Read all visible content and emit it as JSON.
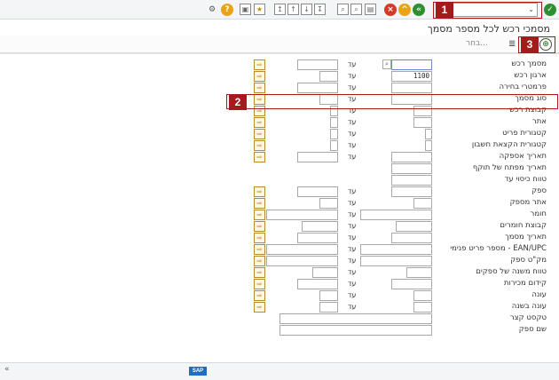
{
  "window": {
    "title": "מסמכי רכש לכל מספר מסמך"
  },
  "toolbar": {
    "command_value": "",
    "icons": [
      "check-icon",
      "back-icon",
      "exit-icon",
      "cancel-icon",
      "print-icon",
      "find-icon",
      "find-next-icon",
      "first-page-icon",
      "prev-page-icon",
      "next-page-icon",
      "last-page-icon",
      "new-session-icon",
      "shortcut-icon",
      "help-icon",
      "settings-icon"
    ]
  },
  "app_toolbar": {
    "choose_label": "בחר..."
  },
  "form": {
    "to_label": "עד",
    "rows": [
      {
        "label": "מסמך רכש",
        "from": "",
        "to": ""
      },
      {
        "label": "ארגון רכש",
        "from": "1100",
        "to": ""
      },
      {
        "label": "פרמטרי בחירה",
        "from": "",
        "to": ""
      },
      {
        "label": "סוג מסמך",
        "from": "",
        "to": ""
      },
      {
        "label": "קבוצת רכש",
        "from": "",
        "to": ""
      },
      {
        "label": "אתר",
        "from": "",
        "to": ""
      },
      {
        "label": "קטגורית פריט",
        "from": "",
        "to": ""
      },
      {
        "label": "קטגורית הקצאת חשבון",
        "from": "",
        "to": ""
      },
      {
        "label": "תאריך אספקה",
        "from": "",
        "to": ""
      },
      {
        "label": "תאריך מפתח של תוקף",
        "from": ""
      },
      {
        "label": "טווח כיסוי עד",
        "from": ""
      },
      {
        "label": "ספק",
        "from": "",
        "to": ""
      },
      {
        "label": "אתר מספק",
        "from": "",
        "to": ""
      },
      {
        "label": "חומר",
        "from": "",
        "to": ""
      },
      {
        "label": "קבוצת חומרים",
        "from": "",
        "to": ""
      },
      {
        "label": "תאריך מסמך",
        "from": "",
        "to": ""
      },
      {
        "label": "מספר פריט פנימי - EAN/UPC",
        "from": "",
        "to": ""
      },
      {
        "label": "מק\"ט ספק",
        "from": "",
        "to": ""
      },
      {
        "label": "טווח משנה של ספקים",
        "from": "",
        "to": ""
      },
      {
        "label": "קידום מכירות",
        "from": "",
        "to": ""
      },
      {
        "label": "עונה",
        "from": "",
        "to": ""
      },
      {
        "label": "עונה בשנה",
        "from": "",
        "to": ""
      },
      {
        "label": "טקסט קצר",
        "from": ""
      },
      {
        "label": "שם ספק",
        "from": ""
      }
    ]
  },
  "annotations": {
    "tag1": "1",
    "tag2": "2",
    "tag3": "3"
  },
  "status": {
    "logo_text": "SAP",
    "arrow": "«"
  },
  "colors": {
    "annotation": "#a31b1b",
    "multi_select": "#b58b2d"
  }
}
